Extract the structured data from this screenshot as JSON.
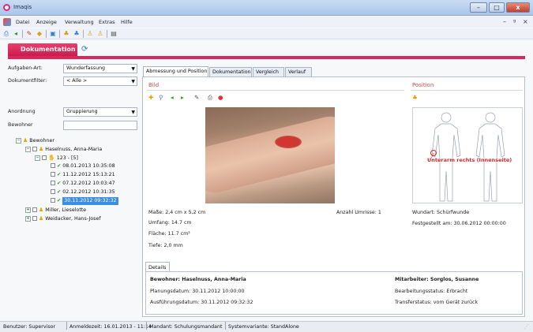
{
  "window": {
    "title": "Imaqis",
    "minimize": "–",
    "maximize": "□",
    "close": "x"
  },
  "menu": {
    "items": [
      "Datei",
      "Anzeige",
      "Verwaltung",
      "Extras",
      "Hilfe"
    ],
    "mdi_min": "–",
    "mdi_restore": "ᵍ",
    "mdi_close": "×"
  },
  "module": {
    "tab_label": "Dokumentation"
  },
  "filters": {
    "task_type_label": "Aufgaben-Art:",
    "task_type_value": "Wunderfassung",
    "doc_filter_label": "Dokumentfilter:",
    "doc_filter_value": "< Alle >",
    "arrangement_label": "Anordnung",
    "arrangement_value": "Gruppierung",
    "residents_label": "Bewohner"
  },
  "tree": {
    "root": "Bewohner",
    "res1": "Haselnuss, Anna-Maria",
    "wound_group": "123 - [5]",
    "entries": [
      "08.01.2013 10:35:08",
      "11.12.2012 15:13:21",
      "07.12.2012 10:03:47",
      "02.12.2012 10:31:35",
      "30.11.2012 09:32:32"
    ],
    "res2": "Miller, Lieselotte",
    "res3": "Weidacker, Hans-Josef"
  },
  "tabs": [
    "Abmessung und Position",
    "Dokumentation",
    "Vergleich",
    "Verlauf"
  ],
  "image_section": {
    "title": "Bild"
  },
  "position_section": {
    "title": "Position",
    "body_label": "Unterarm rechts (Innenseite)"
  },
  "measurements": {
    "size": "Maße: 2,4 cm x 5,2 cm",
    "circumference": "Umfang: 14.7 cm",
    "area": "Fläche: 11.7 cm²",
    "depth": "Tiefe: 2,0 mm",
    "outlines": "Anzahl Umrisse: 1"
  },
  "wound": {
    "type": "Wundart: Schürfwunde",
    "found": "Festgestellt am: 30.06.2012 00:00:00"
  },
  "details": {
    "tab": "Details",
    "resident": "Bewohner: Haselnuss, Anna-Maria",
    "planned": "Planungsdatum: 30.11.2012 10:00:00",
    "executed": "Ausführungsdatum: 30.11.2012 09:32:32",
    "staff": "Mitarbeiter: Sorglos, Susanne",
    "edit_status": "Bearbeitungsstatus: Erbracht",
    "transfer_status": "Transferstatus: vom Gerät zurück"
  },
  "statusbar": {
    "user": "Benutzer: Supervisor",
    "login": "Anmeldezeit: 16.01.2013 - 11:14",
    "tenant": "Mandant: Schulungsmandant",
    "variant": "Systemvariante: StandAlone"
  },
  "colors": {
    "accent": "#d9285b",
    "selection": "#3b8ee0",
    "section_title": "#d14a4a"
  }
}
